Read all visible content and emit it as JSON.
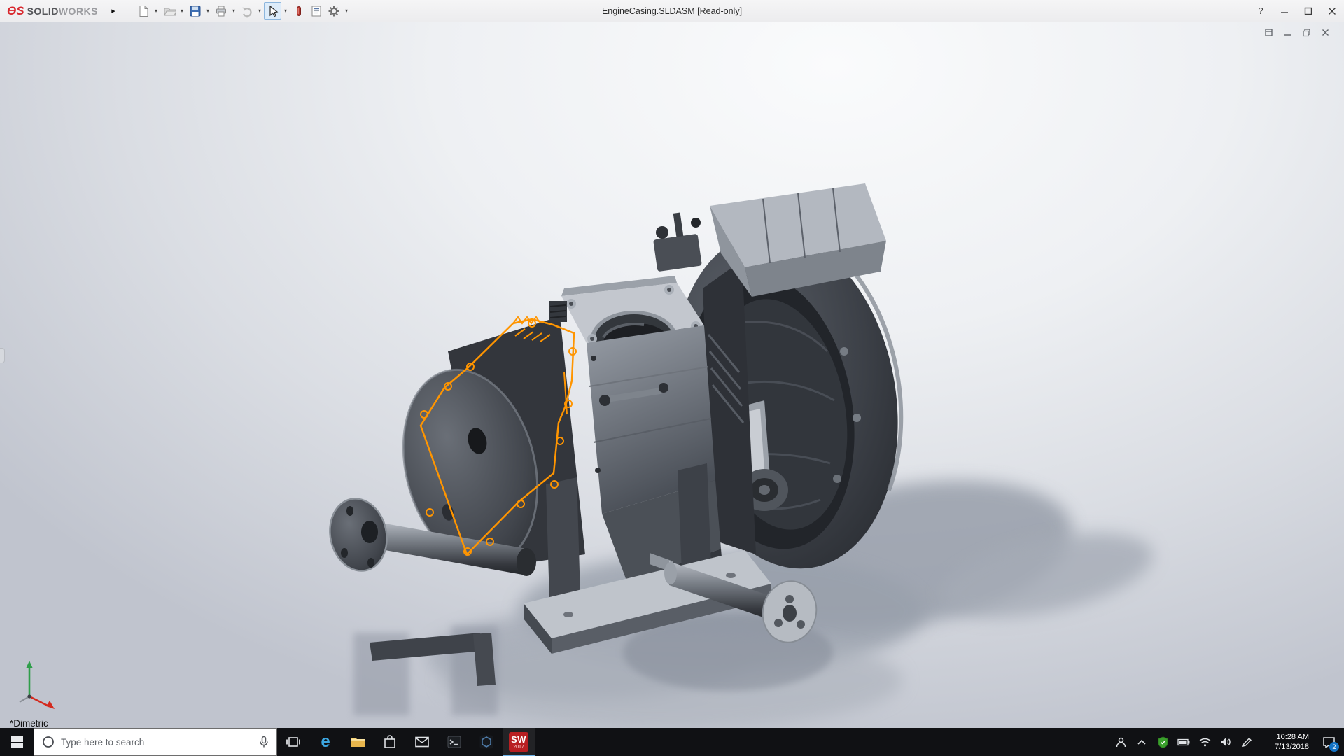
{
  "titlebar": {
    "brand_bold": "SOLID",
    "brand_light": "WORKS",
    "title": "EngineCasing.SLDASM [Read-only]"
  },
  "icons": {
    "flyout_arrow": "▸",
    "dropdown_arrow": "▾",
    "help_glyph": "?",
    "edge_glyph": "e"
  },
  "viewport": {
    "view_label": "*Dimetric"
  },
  "taskbar": {
    "search_placeholder": "Type here to search",
    "sw_icon_text": "SW",
    "sw_icon_year": "2017",
    "time": "10:28 AM",
    "date": "7/13/2018",
    "action_center_badge": "2"
  },
  "colors": {
    "solidworks_red": "#d8262c",
    "sketch_orange": "#ff9500",
    "taskbar_bg": "#101114"
  }
}
